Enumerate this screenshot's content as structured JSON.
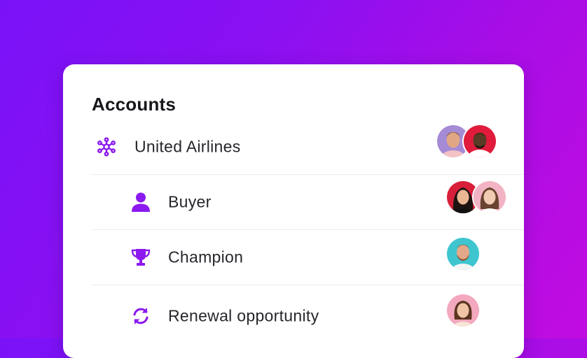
{
  "card": {
    "title": "Accounts"
  },
  "rows": [
    {
      "label": "United Airlines",
      "icon": "network-hub-icon"
    },
    {
      "label": "Buyer",
      "icon": "person-icon"
    },
    {
      "label": "Champion",
      "icon": "trophy-icon"
    },
    {
      "label": "Renewal opportunity",
      "icon": "refresh-icon"
    }
  ],
  "colors": {
    "accent": "#8b19f0",
    "background_start": "#7a12f8",
    "background_end": "#c10ce0",
    "divider": "#ececef"
  }
}
